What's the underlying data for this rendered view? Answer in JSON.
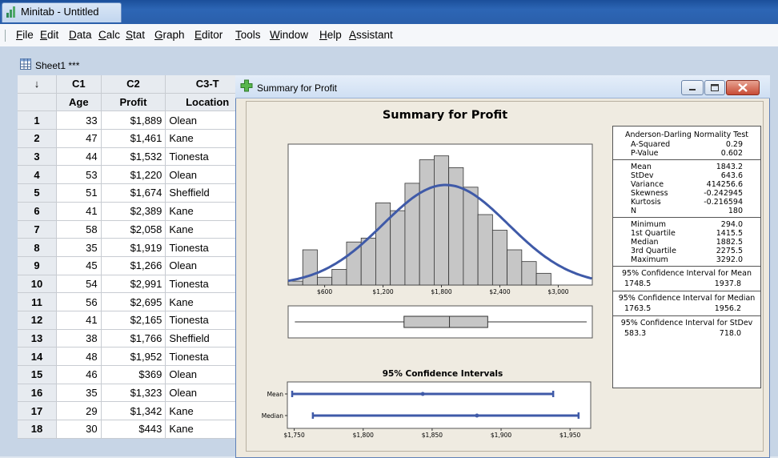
{
  "app": {
    "title": "Minitab - Untitled"
  },
  "menu": [
    "File",
    "Edit",
    "Data",
    "Calc",
    "Stat",
    "Graph",
    "Editor",
    "Tools",
    "Window",
    "Help",
    "Assistant"
  ],
  "menu_underline": [
    0,
    0,
    0,
    0,
    0,
    0,
    0,
    0,
    0,
    0,
    0
  ],
  "sheet": {
    "title": "Sheet1 ***",
    "arrow": "↓",
    "columns": [
      "C1",
      "C2",
      "C3-T"
    ],
    "names": [
      "Age",
      "Profit",
      "Location"
    ],
    "rows": [
      [
        "1",
        "33",
        "$1,889",
        "Olean"
      ],
      [
        "2",
        "47",
        "$1,461",
        "Kane"
      ],
      [
        "3",
        "44",
        "$1,532",
        "Tionesta"
      ],
      [
        "4",
        "53",
        "$1,220",
        "Olean"
      ],
      [
        "5",
        "51",
        "$1,674",
        "Sheffield"
      ],
      [
        "6",
        "41",
        "$2,389",
        "Kane"
      ],
      [
        "7",
        "58",
        "$2,058",
        "Kane"
      ],
      [
        "8",
        "35",
        "$1,919",
        "Tionesta"
      ],
      [
        "9",
        "45",
        "$1,266",
        "Olean"
      ],
      [
        "10",
        "54",
        "$2,991",
        "Tionesta"
      ],
      [
        "11",
        "56",
        "$2,695",
        "Kane"
      ],
      [
        "12",
        "41",
        "$2,165",
        "Tionesta"
      ],
      [
        "13",
        "38",
        "$1,766",
        "Sheffield"
      ],
      [
        "14",
        "48",
        "$1,952",
        "Tionesta"
      ],
      [
        "15",
        "46",
        "$369",
        "Olean"
      ],
      [
        "16",
        "35",
        "$1,323",
        "Olean"
      ],
      [
        "17",
        "29",
        "$1,342",
        "Kane"
      ],
      [
        "18",
        "30",
        "$443",
        "Kane"
      ]
    ]
  },
  "graph": {
    "window_title": "Summary for Profit",
    "chart_title": "Summary for Profit",
    "ci_title": "95% Confidence Intervals",
    "stats": {
      "ad_title": "Anderson-Darling Normality Test",
      "ad": [
        [
          "A-Squared",
          "0.29"
        ],
        [
          "P-Value",
          "0.602"
        ]
      ],
      "moments": [
        [
          "Mean",
          "1843.2"
        ],
        [
          "StDev",
          "643.6"
        ],
        [
          "Variance",
          "414256.6"
        ],
        [
          "Skewness",
          "-0.242945"
        ],
        [
          "Kurtosis",
          "-0.216594"
        ],
        [
          "N",
          "180"
        ]
      ],
      "quartiles": [
        [
          "Minimum",
          "294.0"
        ],
        [
          "1st Quartile",
          "1415.5"
        ],
        [
          "Median",
          "1882.5"
        ],
        [
          "3rd Quartile",
          "2275.5"
        ],
        [
          "Maximum",
          "3292.0"
        ]
      ],
      "ci_mean_title": "95% Confidence Interval for Mean",
      "ci_mean": [
        "1748.5",
        "1937.8"
      ],
      "ci_median_title": "95% Confidence Interval for Median",
      "ci_median": [
        "1763.5",
        "1956.2"
      ],
      "ci_sd_title": "95% Confidence Interval for StDev",
      "ci_sd": [
        "583.3",
        "718.0"
      ]
    }
  },
  "chart_data": [
    {
      "type": "bar",
      "subtype": "histogram",
      "bin_width": 150,
      "bins_start": 225,
      "values": [
        1,
        9,
        2,
        4,
        11,
        12,
        21,
        19,
        26,
        32,
        33,
        30,
        25,
        18,
        14,
        9,
        6,
        3
      ],
      "xlim": [
        225,
        3350
      ],
      "x_ticks": [
        "$600",
        "$1,200",
        "$1,800",
        "$2,400",
        "$3,000"
      ],
      "x_tick_values": [
        600,
        1200,
        1800,
        2400,
        3000
      ],
      "fitted_normal": {
        "mean": 1843.2,
        "stdev": 643.6
      },
      "colors": {
        "bar": "#c6c6c6",
        "curve": "#3f5aa8"
      }
    },
    {
      "type": "boxplot",
      "whisker_low": 294.0,
      "q1": 1415.5,
      "median": 1882.5,
      "q3": 2275.5,
      "whisker_high": 3292.0
    },
    {
      "type": "interval",
      "title": "95% Confidence Intervals",
      "categories": [
        "Mean",
        "Median"
      ],
      "intervals": [
        [
          1748.5,
          1843.2,
          1937.8
        ],
        [
          1763.5,
          1882.5,
          1956.2
        ]
      ],
      "xlim": [
        1745,
        1965
      ],
      "x_ticks": [
        "$1,750",
        "$1,800",
        "$1,850",
        "$1,900",
        "$1,950"
      ],
      "x_tick_values": [
        1750,
        1800,
        1850,
        1900,
        1950
      ]
    }
  ]
}
